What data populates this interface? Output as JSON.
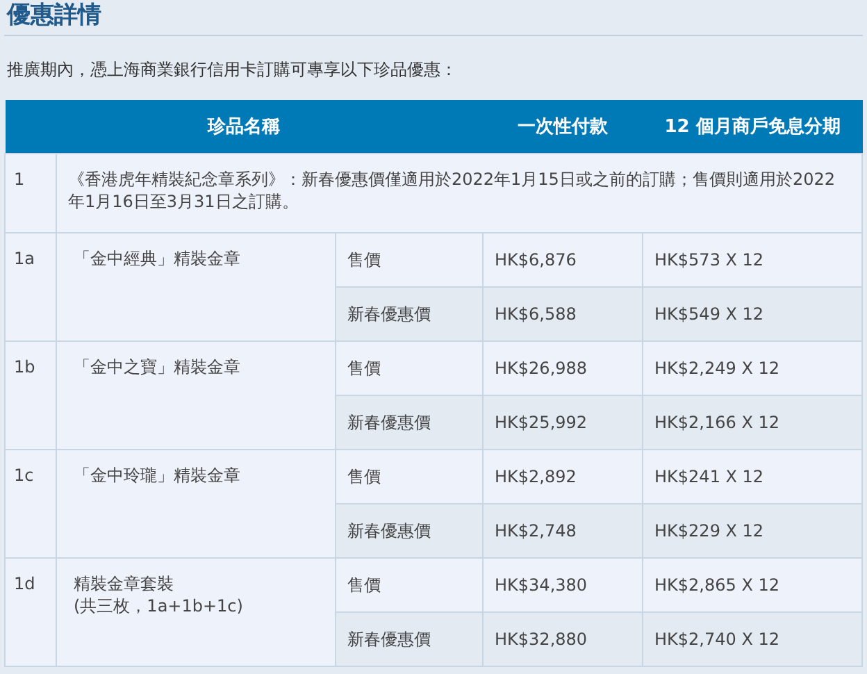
{
  "title": "優惠詳情",
  "intro": "推廣期內，憑上海商業銀行信用卡訂購可專享以下珍品優惠：",
  "table": {
    "columns": [
      "珍品名稱",
      "一次性付款",
      "12 個月商戶免息分期"
    ],
    "note_row": {
      "number": "1",
      "text": "《香港虎年精裝紀念章系列》：新春優惠價僅適用於2022年1月15日或之前的訂購；售價則適用於2022年1月16日至3月31日之訂購。"
    },
    "rows": [
      {
        "number": "1a",
        "name": [
          "「金中經典」精裝金章"
        ],
        "prices": [
          {
            "label": "售價",
            "payment": "HK$6,876",
            "installment": "HK$573 X 12"
          },
          {
            "label": "新春優惠價",
            "payment": "HK$6,588",
            "installment": "HK$549 X 12"
          }
        ]
      },
      {
        "number": "1b",
        "name": [
          "「金中之寶」精裝金章"
        ],
        "prices": [
          {
            "label": "售價",
            "payment": "HK$26,988",
            "installment": "HK$2,249 X 12"
          },
          {
            "label": "新春優惠價",
            "payment": "HK$25,992",
            "installment": "HK$2,166 X 12"
          }
        ]
      },
      {
        "number": "1c",
        "name": [
          "「金中玲瓏」精裝金章"
        ],
        "prices": [
          {
            "label": "售價",
            "payment": "HK$2,892",
            "installment": "HK$241 X 12"
          },
          {
            "label": "新春優惠價",
            "payment": "HK$2,748",
            "installment": "HK$229 X 12"
          }
        ]
      },
      {
        "number": "1d",
        "name": [
          "精裝金章套裝",
          "(共三枚，1a+1b+1c)"
        ],
        "prices": [
          {
            "label": "售價",
            "payment": "HK$34,380",
            "installment": "HK$2,865 X 12"
          },
          {
            "label": "新春優惠價",
            "payment": "HK$32,880",
            "installment": "HK$2,740 X 12"
          }
        ]
      }
    ]
  }
}
